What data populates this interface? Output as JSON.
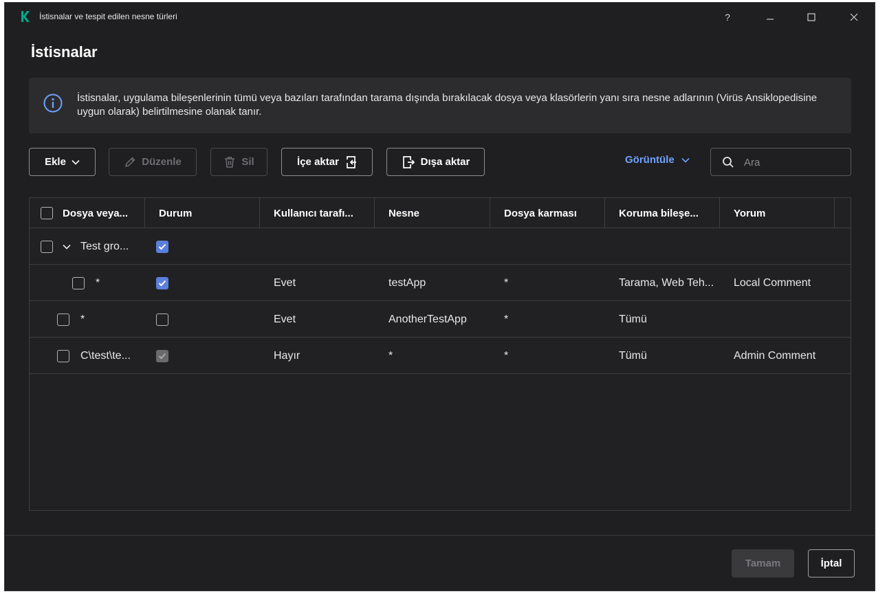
{
  "window": {
    "title": "İstisnalar ve tespit edilen nesne türleri",
    "help": "?"
  },
  "page": {
    "title": "İstisnalar",
    "info": "İstisnalar, uygulama bileşenlerinin tümü veya bazıları tarafından tarama dışında bırakılacak dosya veya klasörlerin yanı sıra nesne adlarının (Virüs Ansiklopedisine uygun olarak) belirtilmesine olanak tanır."
  },
  "toolbar": {
    "add": "Ekle",
    "edit": "Düzenle",
    "delete": "Sil",
    "import": "İçe aktar",
    "export": "Dışa aktar",
    "view": "Görüntüle",
    "search_placeholder": "Ara"
  },
  "table": {
    "columns": [
      "Dosya veya...",
      "Durum",
      "Kullanıcı tarafı...",
      "Nesne",
      "Dosya karması",
      "Koruma bileşe...",
      "Yorum"
    ],
    "rows": [
      {
        "name": "Test gro...",
        "status": "checked",
        "user": "",
        "object": "",
        "hash": "",
        "components": "",
        "comment": ""
      },
      {
        "name": "*",
        "status": "checked",
        "user": "Evet",
        "object": "testApp",
        "hash": "*",
        "components": "Tarama, Web Teh...",
        "comment": "Local Comment"
      },
      {
        "name": "*",
        "status": "unchecked",
        "user": "Evet",
        "object": "AnotherTestApp",
        "hash": "*",
        "components": "Tümü",
        "comment": ""
      },
      {
        "name": "C\\test\\te...",
        "status": "checked-disabled",
        "user": "Hayır",
        "object": "*",
        "hash": "*",
        "components": "Tümü",
        "comment": "Admin Comment"
      }
    ]
  },
  "footer": {
    "ok": "Tamam",
    "cancel": "İptal"
  },
  "colors": {
    "background": "#1f1f21",
    "accent": "#5b7fdc",
    "link": "#6ea2ff",
    "brand": "#00a88e"
  }
}
